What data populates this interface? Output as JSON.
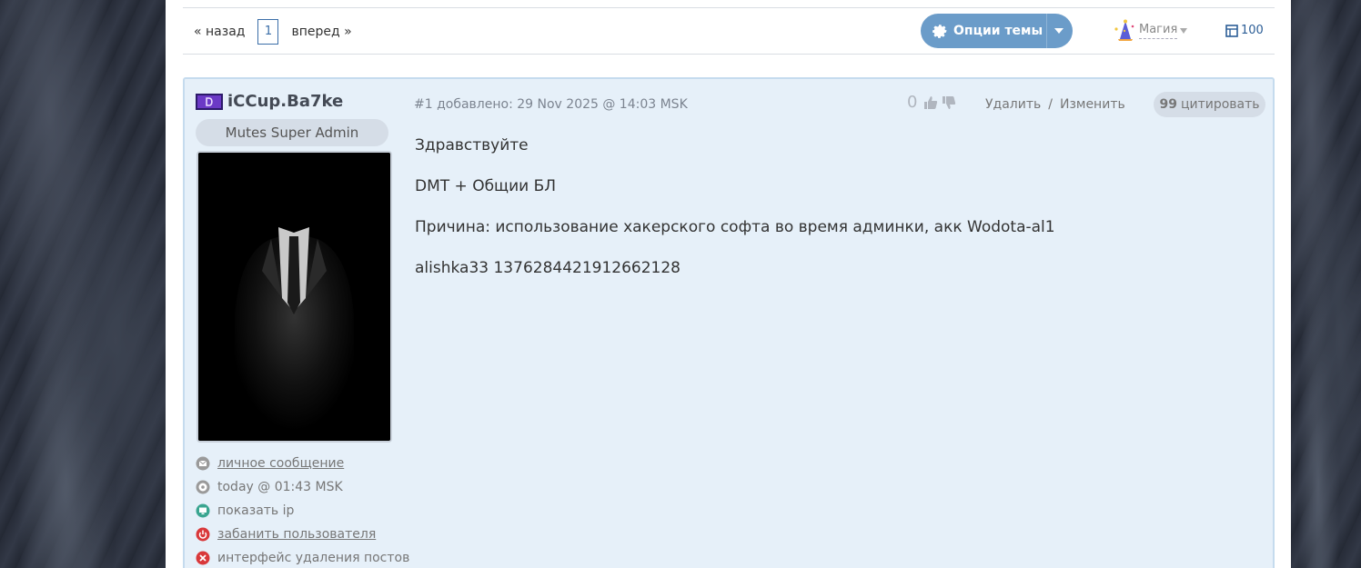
{
  "pager": {
    "prev": "« назад",
    "current": "1",
    "next": "вперед »"
  },
  "toolbar": {
    "options_label": "Опции темы",
    "magic_label": "Магия",
    "count": "100"
  },
  "post": {
    "author": "iCCup.Ba7ke",
    "rank": "Mutes Super Admin",
    "meta": "#1 добавлено: 29 Nov 2025 @ 14:03 MSK",
    "score": "0",
    "delete_label": "Удалить",
    "separator": "/",
    "edit_label": "Изменить",
    "quote_icon": "99",
    "quote_label": "цитировать",
    "lines": [
      "Здравствуйте",
      "DMT + Общии БЛ",
      "Причина: использование хакерского софта во время админки, акк Wodota-al1",
      "alishka33 1376284421912662128"
    ]
  },
  "sidebar": {
    "links": [
      {
        "label": "личное сообщение",
        "icon": "mail-icon",
        "color": "#9a9a9a"
      },
      {
        "label": "today @ 01:43 MSK",
        "icon": "clock-icon",
        "color": "#9a9a9a"
      },
      {
        "label": "показать ip",
        "icon": "monitor-icon",
        "color": "#3aa590"
      },
      {
        "label": "забанить пользователя",
        "icon": "power-icon",
        "color": "#d9383a"
      },
      {
        "label": "интерфейс удаления постов",
        "icon": "close-icon",
        "color": "#d9383a"
      }
    ]
  },
  "colors": {
    "accent": "#6b9cc9",
    "post_bg": "#e6f0f9",
    "link": "#2b5d96"
  }
}
